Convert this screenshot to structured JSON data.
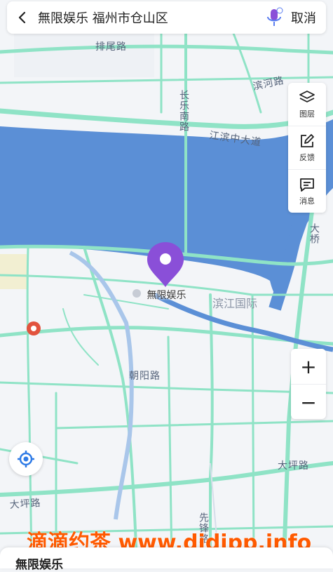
{
  "search": {
    "query": "無限娱乐 福州市仓山区",
    "cancel_label": "取消"
  },
  "toolbox": {
    "items": [
      {
        "icon": "layers-icon",
        "label": "图层"
      },
      {
        "icon": "feedback-icon",
        "label": "反馈"
      },
      {
        "icon": "message-icon",
        "label": "消息"
      }
    ]
  },
  "zoom": {
    "in": "+",
    "out": "−"
  },
  "map": {
    "roads": {
      "paiwei": "排尾路",
      "binhe": "滨河路",
      "changle_south": "长乐南路",
      "jiangbin": "江滨中大道",
      "bridge": "大桥",
      "chaoyang": "朝阳路",
      "daping1": "大坪路",
      "daping2": "大坪路",
      "xianfeng": "先锋路"
    },
    "poi": {
      "binjiang": "滨江国际"
    },
    "pin": {
      "label": "無限娱乐"
    }
  },
  "watermark": "滴滴约茶 www.didipp.info",
  "sheet": {
    "title": "無限娱乐"
  },
  "colors": {
    "water": "#5b8fd6",
    "road": "#8fe3c6",
    "pin": "#8a4fd8",
    "accent": "#ff5a00"
  }
}
